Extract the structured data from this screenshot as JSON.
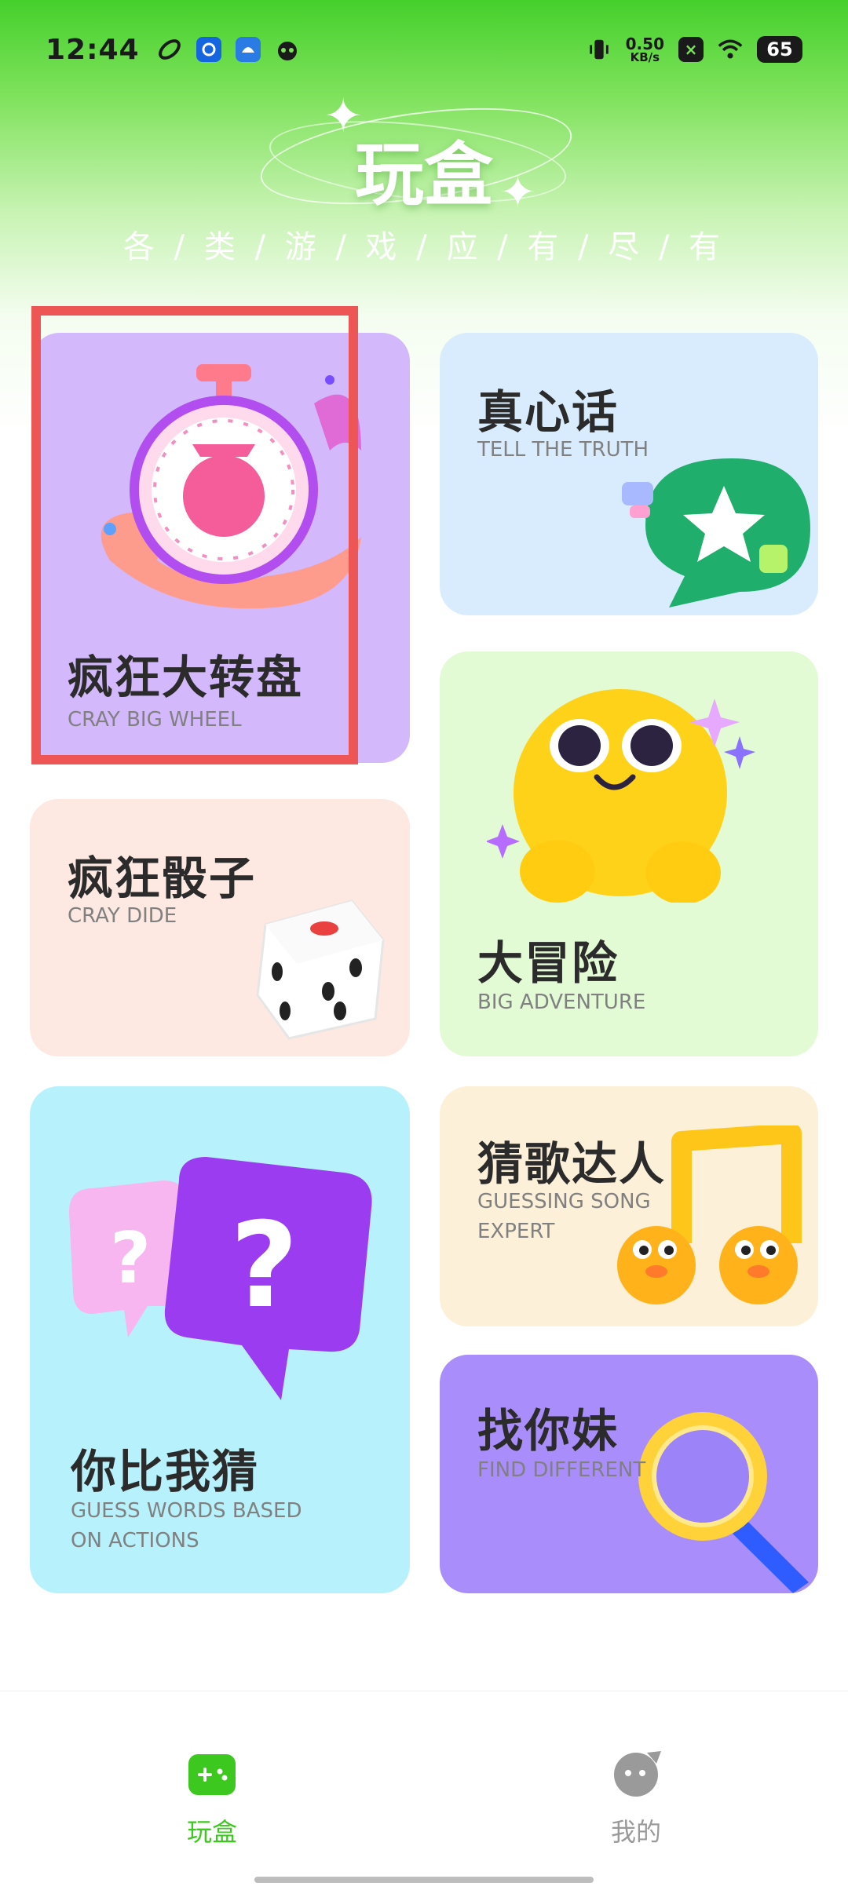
{
  "status_bar": {
    "time": "12:44",
    "net_speed_value": "0.50",
    "net_speed_unit": "KB/s",
    "battery": "65",
    "left_icons": [
      "app-icon-1",
      "app-icon-2",
      "app-icon-3",
      "app-icon-4"
    ],
    "right_icons": [
      "vibrate-icon",
      "sim-off-icon",
      "wifi-icon",
      "battery-icon"
    ]
  },
  "header": {
    "title": "玩盒",
    "subtitle": "各 / 类 / 游 / 戏 / 应 / 有 / 尽 / 有"
  },
  "cards": [
    {
      "title": "疯狂大转盘",
      "subtitle": "CRAY BIG WHEEL",
      "icon": "stopwatch-icon",
      "bg": "#d3b8fb"
    },
    {
      "title": "真心话",
      "subtitle": "TELL THE TRUTH",
      "icon": "chat-star-icon",
      "bg": "#d9ecfd"
    },
    {
      "title": "疯狂骰子",
      "subtitle": "CRAY DIDE",
      "icon": "dice-icon",
      "bg": "#fde9e1"
    },
    {
      "title": "大冒险",
      "subtitle": "BIG ADVENTURE",
      "icon": "smiley-icon",
      "bg": "#e2fbd5"
    },
    {
      "title": "你比我猜",
      "subtitle_line1": "GUESS WORDS BASED",
      "subtitle_line2": "ON ACTIONS",
      "icon": "question-bubbles-icon",
      "bg": "#b7f1fb"
    },
    {
      "title": "猜歌达人",
      "subtitle_line1": "GUESSING SONG",
      "subtitle_line2": "EXPERT",
      "icon": "music-note-icon",
      "bg": "#fcf0d9"
    },
    {
      "title": "找你妹",
      "subtitle": "FIND DIFFERENT",
      "icon": "magnifier-icon",
      "bg": "#a98dfa"
    }
  ],
  "bottom_nav": [
    {
      "label": "玩盒",
      "icon": "gamepad-icon",
      "active": true,
      "color": "#3cc81e"
    },
    {
      "label": "我的",
      "icon": "profile-icon",
      "active": false,
      "color": "#9a9a9a"
    }
  ]
}
